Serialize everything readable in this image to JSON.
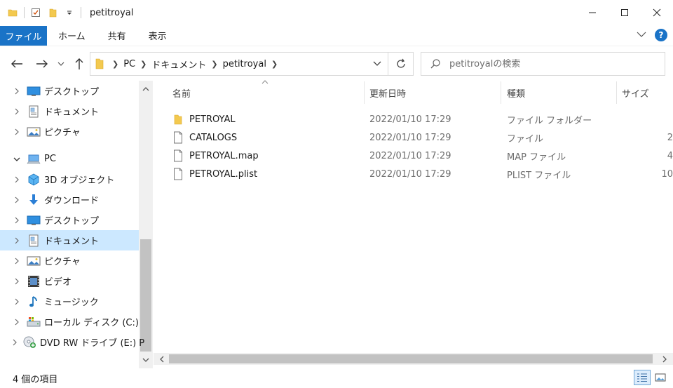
{
  "window": {
    "title": "petitroyal",
    "controls": {
      "minimize": "─",
      "maximize": "☐",
      "close": "✕"
    }
  },
  "ribbon": {
    "file_tab": "ファイル",
    "tabs": [
      "ホーム",
      "共有",
      "表示"
    ],
    "help": "?"
  },
  "address": {
    "crumbs": [
      "PC",
      "ドキュメント",
      "petitroyal"
    ]
  },
  "search": {
    "placeholder": "petitroyalの検索"
  },
  "nav_pane": {
    "items": [
      {
        "label": "デスクトップ",
        "icon": "desktop-icon",
        "chevron": "›"
      },
      {
        "label": "ドキュメント",
        "icon": "documents-icon",
        "chevron": "›"
      },
      {
        "label": "ピクチャ",
        "icon": "pictures-icon",
        "chevron": "›"
      },
      {
        "label": "PC",
        "icon": "pc-icon",
        "chevron": "⌄"
      },
      {
        "label": "3D オブジェクト",
        "icon": "3d-objects-icon",
        "chevron": "›"
      },
      {
        "label": "ダウンロード",
        "icon": "downloads-icon",
        "chevron": "›"
      },
      {
        "label": "デスクトップ",
        "icon": "desktop-icon",
        "chevron": "›"
      },
      {
        "label": "ドキュメント",
        "icon": "documents-icon",
        "chevron": "›",
        "selected": true
      },
      {
        "label": "ピクチャ",
        "icon": "pictures-icon",
        "chevron": "›"
      },
      {
        "label": "ビデオ",
        "icon": "videos-icon",
        "chevron": "›"
      },
      {
        "label": "ミュージック",
        "icon": "music-icon",
        "chevron": "›"
      },
      {
        "label": "ローカル ディスク (C:)",
        "icon": "local-disk-icon",
        "chevron": "›"
      },
      {
        "label": "DVD RW ドライブ (E:) P",
        "icon": "dvd-drive-icon",
        "chevron": "›"
      }
    ]
  },
  "columns": {
    "name": "名前",
    "date": "更新日時",
    "type": "種類",
    "size": "サイズ"
  },
  "files": [
    {
      "name": "PETROYAL",
      "date": "2022/01/10 17:29",
      "type": "ファイル フォルダー",
      "size": "",
      "icon": "folder-icon"
    },
    {
      "name": "CATALOGS",
      "date": "2022/01/10 17:29",
      "type": "ファイル",
      "size": "2",
      "icon": "file-icon"
    },
    {
      "name": "PETROYAL.map",
      "date": "2022/01/10 17:29",
      "type": "MAP ファイル",
      "size": "4",
      "icon": "file-icon"
    },
    {
      "name": "PETROYAL.plist",
      "date": "2022/01/10 17:29",
      "type": "PLIST ファイル",
      "size": "10",
      "icon": "file-icon"
    }
  ],
  "status": {
    "item_count": "4 個の項目"
  },
  "colors": {
    "accent": "#1a73c7",
    "selection": "#cce8ff",
    "folder": "#f3c94f"
  }
}
